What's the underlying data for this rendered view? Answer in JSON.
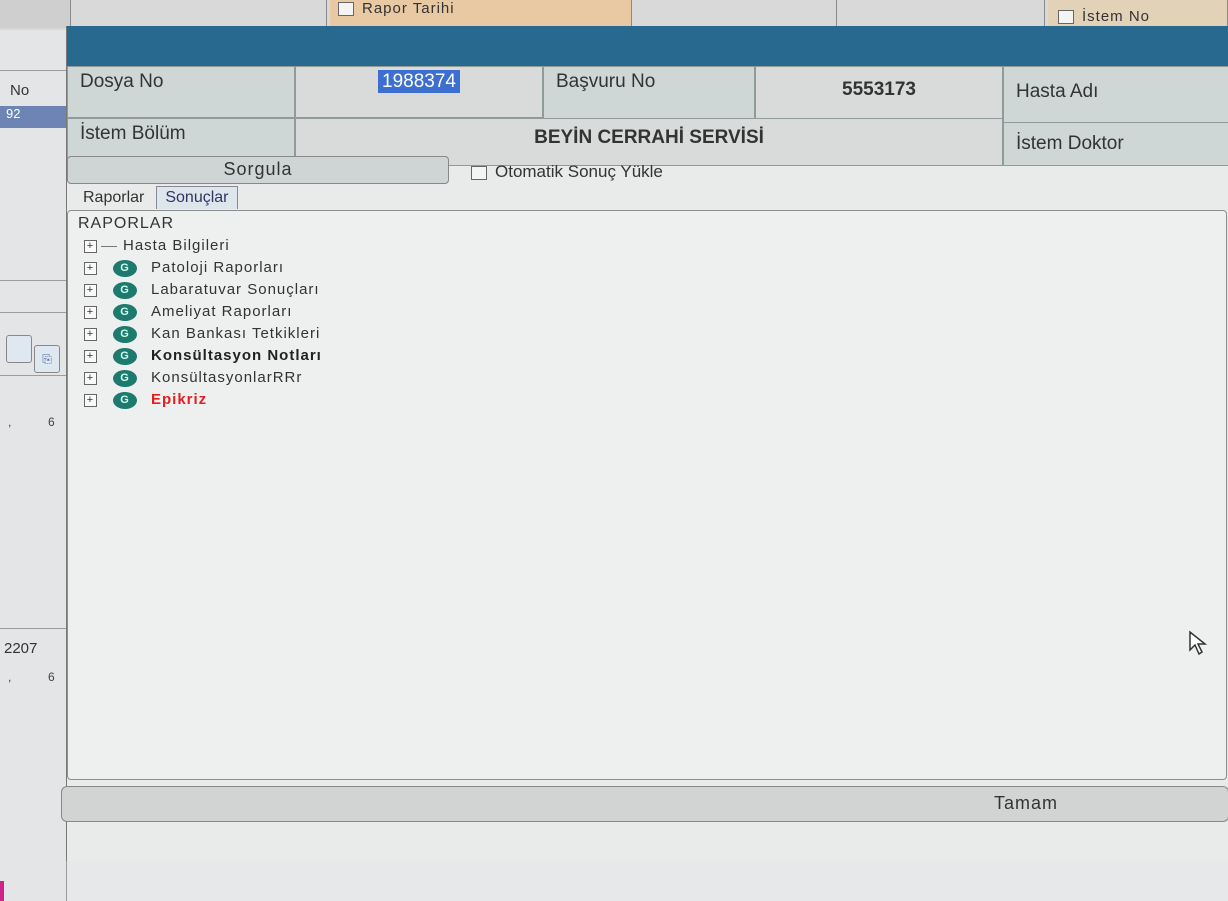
{
  "background": {
    "header_cells": [
      {
        "label": "Rapor Tarihi"
      },
      {
        "label": "İstem No"
      }
    ],
    "left_column": {
      "header": "No",
      "selected_row": "92",
      "number": "2207",
      "tick_1": "6",
      "tick_2": "6"
    }
  },
  "dialog": {
    "info": {
      "dosya_label": "Dosya No",
      "dosya_value": "1988374",
      "basvuru_label": "Başvuru No",
      "basvuru_value": "5553173",
      "hasta_label": "Hasta Adı",
      "istem_bolum_label": "İstem Bölüm",
      "istem_bolum_value": "BEYİN CERRAHİ SERVİSİ",
      "istem_doktor_label": "İstem Doktor"
    },
    "toolbar": {
      "sorgula_label": "Sorgula",
      "auto_load_label": "Otomatik Sonuç Yükle"
    },
    "tabs": [
      {
        "label": "Raporlar",
        "active": true
      },
      {
        "label": "Sonuçlar",
        "active": false
      }
    ],
    "tree": {
      "root": "RAPORLAR",
      "items": [
        {
          "label": "Hasta Bilgileri",
          "icon": "none",
          "style": "normal"
        },
        {
          "label": "Patoloji Raporları",
          "icon": "g-circle-icon",
          "style": "normal"
        },
        {
          "label": "Labaratuvar Sonuçları",
          "icon": "g-circle-icon",
          "style": "normal"
        },
        {
          "label": "Ameliyat Raporları",
          "icon": "g-circle-icon",
          "style": "normal"
        },
        {
          "label": "Kan Bankası Tetkikleri",
          "icon": "g-circle-icon",
          "style": "normal"
        },
        {
          "label": "Konsültasyon Notları",
          "icon": "g-circle-icon",
          "style": "bold"
        },
        {
          "label": "KonsültasyonlarRRr",
          "icon": "g-circle-icon",
          "style": "normal"
        },
        {
          "label": "Epikriz",
          "icon": "g-circle-icon",
          "style": "red"
        }
      ]
    },
    "ok_label": "Tamam",
    "colors": {
      "titlebar": "#286a8f",
      "selection": "#3d6fd0",
      "icon": "#1e7a6e",
      "epikriz": "#e02020"
    }
  }
}
